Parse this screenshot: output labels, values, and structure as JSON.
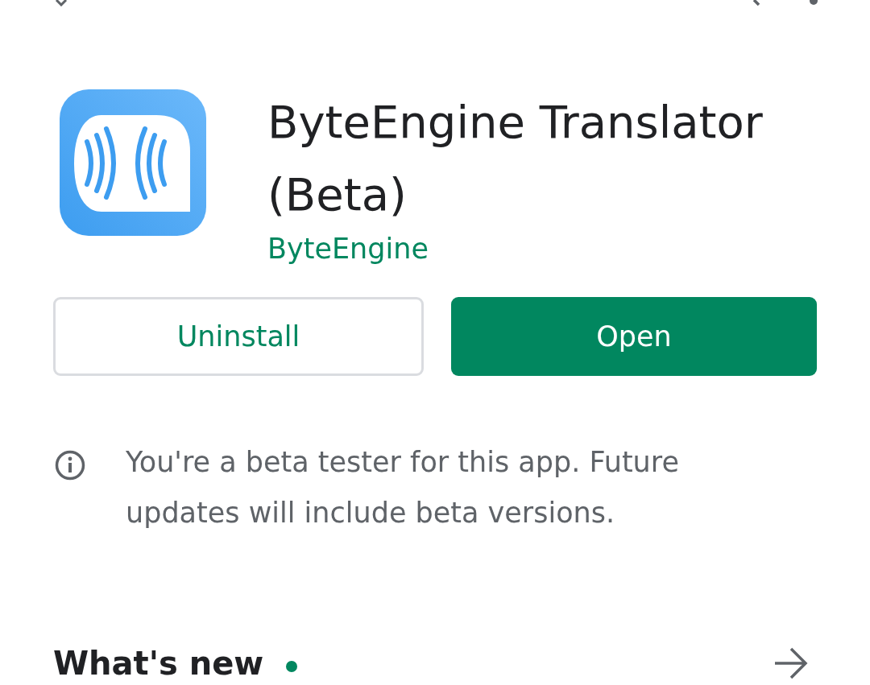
{
  "app": {
    "title": "ByteEngine Translator (Beta)",
    "developer": "ByteEngine"
  },
  "buttons": [
    {
      "label": "Uninstall",
      "kind": "outlined"
    },
    {
      "label": "Open",
      "kind": "filled"
    }
  ],
  "notice": {
    "text": "You're a beta tester for this app. Future updates will include beta versions."
  },
  "whats_new": {
    "title": "What's new",
    "new_dot": true
  }
}
